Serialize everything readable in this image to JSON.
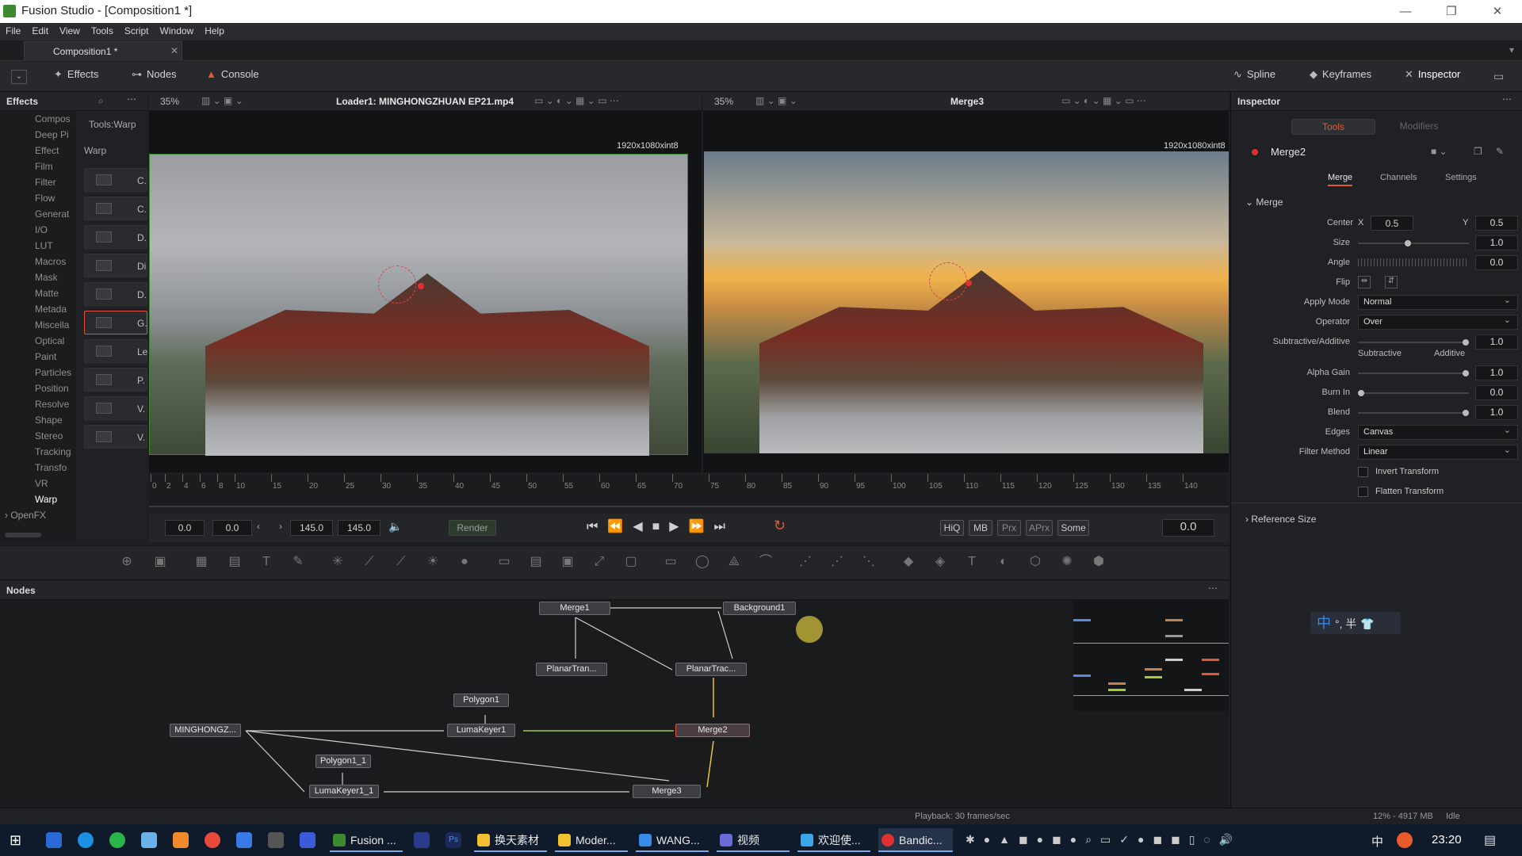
{
  "window": {
    "title": "Fusion Studio - [Composition1 *]",
    "minimize": "—",
    "maximize": "❐",
    "close": "✕"
  },
  "menu": [
    "File",
    "Edit",
    "View",
    "Tools",
    "Script",
    "Window",
    "Help"
  ],
  "composition_tab": {
    "label": "Composition1 *",
    "close": "✕"
  },
  "toolbar": {
    "effects": "Effects",
    "nodes": "Nodes",
    "console": "Console",
    "spline": "Spline",
    "keyframes": "Keyframes",
    "inspector": "Inspector"
  },
  "effects_panel": {
    "title": "Effects",
    "breadcrumb": "Tools:Warp",
    "section": "Warp",
    "categories": [
      "Compos",
      "Deep Pi",
      "Effect",
      "Film",
      "Filter",
      "Flow",
      "Generat",
      "I/O",
      "LUT",
      "Macros",
      "Mask",
      "Matte",
      "Metada",
      "Miscella",
      "Optical",
      "Paint",
      "Particles",
      "Position",
      "Resolve",
      "Shape",
      "Stereo",
      "Tracking",
      "Transfo",
      "VR",
      "Warp"
    ],
    "openfx": "OpenFX",
    "tools": [
      "C.",
      "C.",
      "D.",
      "Di",
      "D.",
      "G.",
      "Le",
      "P.",
      "V.",
      "V."
    ]
  },
  "viewer_left": {
    "zoom": "35%",
    "title": "Loader1: MINGHONGZHUAN EP21.mp4",
    "resolution": "1920x1080xint8"
  },
  "viewer_right": {
    "zoom": "35%",
    "title": "Merge3",
    "resolution": "1920x1080xint8"
  },
  "timeline": {
    "ticks": [
      "0",
      "2",
      "4",
      "6",
      "8",
      "10",
      "15",
      "20",
      "25",
      "30",
      "35",
      "40",
      "45",
      "50",
      "55",
      "60",
      "65",
      "70",
      "75",
      "80",
      "85",
      "90",
      "95",
      "100",
      "105",
      "110",
      "115",
      "120",
      "125",
      "130",
      "135",
      "140"
    ]
  },
  "transport": {
    "start": "0.0",
    "current": "0.0",
    "end": "145.0",
    "render_end": "145.0",
    "render": "Render",
    "hiq": "HiQ",
    "mb": "MB",
    "prx": "Prx",
    "aprx": "APrx",
    "some": "Some",
    "time": "0.0"
  },
  "nodes_panel": {
    "title": "Nodes",
    "nodes": {
      "merge1": "Merge1",
      "background1": "Background1",
      "planar1": "PlanarTran...",
      "planar2": "PlanarTrac...",
      "polygon1": "Polygon1",
      "lumakeyer1": "LumaKeyer1",
      "loader": "MINGHONGZ...",
      "merge2": "Merge2",
      "polygon1_1": "Polygon1_1",
      "lumakeyer1_1": "LumaKeyer1_1",
      "merge3": "Merge3"
    }
  },
  "inspector": {
    "title": "Inspector",
    "tab_tools": "Tools",
    "tab_modifiers": "Modifiers",
    "node_name": "Merge2",
    "subtabs": [
      "Merge",
      "Channels",
      "Settings"
    ],
    "section": "Merge",
    "center_label": "Center",
    "center_x_label": "X",
    "center_x": "0.5",
    "center_y_label": "Y",
    "center_y": "0.5",
    "size_label": "Size",
    "size": "1.0",
    "size_level": 0.45,
    "angle_label": "Angle",
    "angle": "0.0",
    "flip_label": "Flip",
    "apply_mode_label": "Apply Mode",
    "apply_mode": "Normal",
    "operator_label": "Operator",
    "operator": "Over",
    "subadd_label": "Subtractive/Additive",
    "subadd": "1.0",
    "subadd_left": "Subtractive",
    "subadd_right": "Additive",
    "subadd_level": 1.0,
    "alpha_gain_label": "Alpha Gain",
    "alpha_gain": "1.0",
    "alpha_gain_level": 1.0,
    "burn_in_label": "Burn In",
    "burn_in": "0.0",
    "burn_in_level": 0.0,
    "blend_label": "Blend",
    "blend": "1.0",
    "blend_level": 1.0,
    "edges_label": "Edges",
    "edges": "Canvas",
    "filter_label": "Filter Method",
    "filter": "Linear",
    "invert_transform": "Invert Transform",
    "flatten_transform": "Flatten Transform",
    "reference_size": "Reference Size"
  },
  "ime": {
    "label": "中",
    "extra": "°, 半"
  },
  "status": {
    "playback": "Playback: 30 frames/sec",
    "memory": "12% - 4917 MB",
    "state": "Idle"
  },
  "taskbar": {
    "apps": [
      "Fusion ...",
      "换天素材",
      "Moder...",
      "WANG...",
      "视频",
      "欢迎使...",
      "Bandic..."
    ],
    "ime": "中",
    "time": "23:20"
  },
  "colors": {
    "accent": "#e0503c",
    "wire_green": "#9fcc3a",
    "wire_yellow": "#e8c43a",
    "taskbar": "#0f1a2a"
  }
}
